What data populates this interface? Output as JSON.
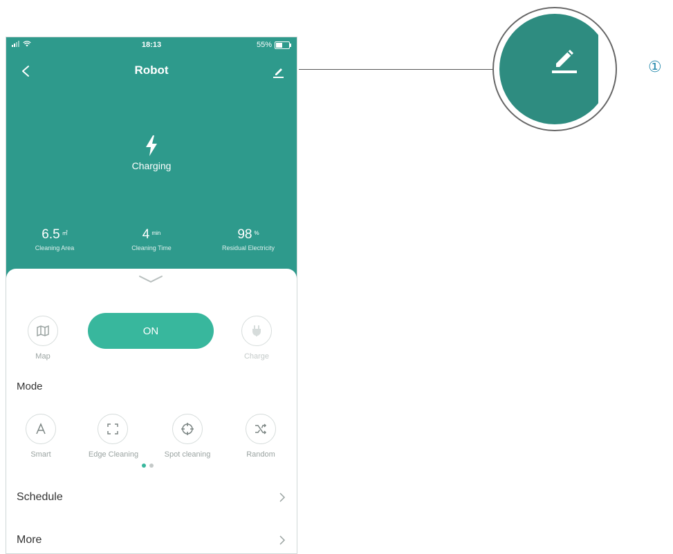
{
  "status_bar": {
    "time": "18:13",
    "battery_text": "55%",
    "battery_level": 0.55
  },
  "navbar": {
    "title": "Robot"
  },
  "device_status": {
    "label": "Charging"
  },
  "stats": [
    {
      "value": "6.5",
      "unit": "㎡",
      "label": "Cleaning Area"
    },
    {
      "value": "4",
      "unit": "min",
      "label": "Cleaning Time"
    },
    {
      "value": "98",
      "unit": "%",
      "label": "Residual Electricity"
    }
  ],
  "controls": {
    "map_label": "Map",
    "power_label": "ON",
    "charge_label": "Charge"
  },
  "mode": {
    "title": "Mode",
    "items": [
      {
        "label": "Smart",
        "icon": "letter-a-icon"
      },
      {
        "label": "Edge Cleaning",
        "icon": "edge-frame-icon"
      },
      {
        "label": "Spot cleaning",
        "icon": "crosshair-icon"
      },
      {
        "label": "Random",
        "icon": "shuffle-icon"
      }
    ],
    "page_index": 1,
    "page_count": 2
  },
  "list": [
    {
      "label": "Schedule"
    },
    {
      "label": "More"
    }
  ],
  "callout": {
    "number": "①",
    "icon": "edit-pencil-icon"
  },
  "colors": {
    "header_teal": "#2e9a8c",
    "accent_green": "#38b79d",
    "callout_blue": "#2f8fb0"
  }
}
